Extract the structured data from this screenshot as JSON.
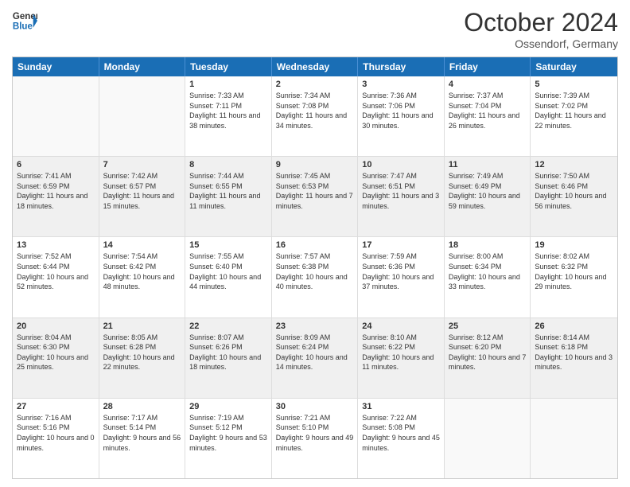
{
  "logo": {
    "line1": "General",
    "line2": "Blue"
  },
  "title": "October 2024",
  "subtitle": "Ossendorf, Germany",
  "days": [
    "Sunday",
    "Monday",
    "Tuesday",
    "Wednesday",
    "Thursday",
    "Friday",
    "Saturday"
  ],
  "rows": [
    [
      {
        "day": "",
        "sunrise": "",
        "sunset": "",
        "daylight": "",
        "empty": true
      },
      {
        "day": "",
        "sunrise": "",
        "sunset": "",
        "daylight": "",
        "empty": true
      },
      {
        "day": "1",
        "sunrise": "Sunrise: 7:33 AM",
        "sunset": "Sunset: 7:11 PM",
        "daylight": "Daylight: 11 hours and 38 minutes."
      },
      {
        "day": "2",
        "sunrise": "Sunrise: 7:34 AM",
        "sunset": "Sunset: 7:08 PM",
        "daylight": "Daylight: 11 hours and 34 minutes."
      },
      {
        "day": "3",
        "sunrise": "Sunrise: 7:36 AM",
        "sunset": "Sunset: 7:06 PM",
        "daylight": "Daylight: 11 hours and 30 minutes."
      },
      {
        "day": "4",
        "sunrise": "Sunrise: 7:37 AM",
        "sunset": "Sunset: 7:04 PM",
        "daylight": "Daylight: 11 hours and 26 minutes."
      },
      {
        "day": "5",
        "sunrise": "Sunrise: 7:39 AM",
        "sunset": "Sunset: 7:02 PM",
        "daylight": "Daylight: 11 hours and 22 minutes."
      }
    ],
    [
      {
        "day": "6",
        "sunrise": "Sunrise: 7:41 AM",
        "sunset": "Sunset: 6:59 PM",
        "daylight": "Daylight: 11 hours and 18 minutes."
      },
      {
        "day": "7",
        "sunrise": "Sunrise: 7:42 AM",
        "sunset": "Sunset: 6:57 PM",
        "daylight": "Daylight: 11 hours and 15 minutes."
      },
      {
        "day": "8",
        "sunrise": "Sunrise: 7:44 AM",
        "sunset": "Sunset: 6:55 PM",
        "daylight": "Daylight: 11 hours and 11 minutes."
      },
      {
        "day": "9",
        "sunrise": "Sunrise: 7:45 AM",
        "sunset": "Sunset: 6:53 PM",
        "daylight": "Daylight: 11 hours and 7 minutes."
      },
      {
        "day": "10",
        "sunrise": "Sunrise: 7:47 AM",
        "sunset": "Sunset: 6:51 PM",
        "daylight": "Daylight: 11 hours and 3 minutes."
      },
      {
        "day": "11",
        "sunrise": "Sunrise: 7:49 AM",
        "sunset": "Sunset: 6:49 PM",
        "daylight": "Daylight: 10 hours and 59 minutes."
      },
      {
        "day": "12",
        "sunrise": "Sunrise: 7:50 AM",
        "sunset": "Sunset: 6:46 PM",
        "daylight": "Daylight: 10 hours and 56 minutes."
      }
    ],
    [
      {
        "day": "13",
        "sunrise": "Sunrise: 7:52 AM",
        "sunset": "Sunset: 6:44 PM",
        "daylight": "Daylight: 10 hours and 52 minutes."
      },
      {
        "day": "14",
        "sunrise": "Sunrise: 7:54 AM",
        "sunset": "Sunset: 6:42 PM",
        "daylight": "Daylight: 10 hours and 48 minutes."
      },
      {
        "day": "15",
        "sunrise": "Sunrise: 7:55 AM",
        "sunset": "Sunset: 6:40 PM",
        "daylight": "Daylight: 10 hours and 44 minutes."
      },
      {
        "day": "16",
        "sunrise": "Sunrise: 7:57 AM",
        "sunset": "Sunset: 6:38 PM",
        "daylight": "Daylight: 10 hours and 40 minutes."
      },
      {
        "day": "17",
        "sunrise": "Sunrise: 7:59 AM",
        "sunset": "Sunset: 6:36 PM",
        "daylight": "Daylight: 10 hours and 37 minutes."
      },
      {
        "day": "18",
        "sunrise": "Sunrise: 8:00 AM",
        "sunset": "Sunset: 6:34 PM",
        "daylight": "Daylight: 10 hours and 33 minutes."
      },
      {
        "day": "19",
        "sunrise": "Sunrise: 8:02 AM",
        "sunset": "Sunset: 6:32 PM",
        "daylight": "Daylight: 10 hours and 29 minutes."
      }
    ],
    [
      {
        "day": "20",
        "sunrise": "Sunrise: 8:04 AM",
        "sunset": "Sunset: 6:30 PM",
        "daylight": "Daylight: 10 hours and 25 minutes."
      },
      {
        "day": "21",
        "sunrise": "Sunrise: 8:05 AM",
        "sunset": "Sunset: 6:28 PM",
        "daylight": "Daylight: 10 hours and 22 minutes."
      },
      {
        "day": "22",
        "sunrise": "Sunrise: 8:07 AM",
        "sunset": "Sunset: 6:26 PM",
        "daylight": "Daylight: 10 hours and 18 minutes."
      },
      {
        "day": "23",
        "sunrise": "Sunrise: 8:09 AM",
        "sunset": "Sunset: 6:24 PM",
        "daylight": "Daylight: 10 hours and 14 minutes."
      },
      {
        "day": "24",
        "sunrise": "Sunrise: 8:10 AM",
        "sunset": "Sunset: 6:22 PM",
        "daylight": "Daylight: 10 hours and 11 minutes."
      },
      {
        "day": "25",
        "sunrise": "Sunrise: 8:12 AM",
        "sunset": "Sunset: 6:20 PM",
        "daylight": "Daylight: 10 hours and 7 minutes."
      },
      {
        "day": "26",
        "sunrise": "Sunrise: 8:14 AM",
        "sunset": "Sunset: 6:18 PM",
        "daylight": "Daylight: 10 hours and 3 minutes."
      }
    ],
    [
      {
        "day": "27",
        "sunrise": "Sunrise: 7:16 AM",
        "sunset": "Sunset: 5:16 PM",
        "daylight": "Daylight: 10 hours and 0 minutes."
      },
      {
        "day": "28",
        "sunrise": "Sunrise: 7:17 AM",
        "sunset": "Sunset: 5:14 PM",
        "daylight": "Daylight: 9 hours and 56 minutes."
      },
      {
        "day": "29",
        "sunrise": "Sunrise: 7:19 AM",
        "sunset": "Sunset: 5:12 PM",
        "daylight": "Daylight: 9 hours and 53 minutes."
      },
      {
        "day": "30",
        "sunrise": "Sunrise: 7:21 AM",
        "sunset": "Sunset: 5:10 PM",
        "daylight": "Daylight: 9 hours and 49 minutes."
      },
      {
        "day": "31",
        "sunrise": "Sunrise: 7:22 AM",
        "sunset": "Sunset: 5:08 PM",
        "daylight": "Daylight: 9 hours and 45 minutes."
      },
      {
        "day": "",
        "sunrise": "",
        "sunset": "",
        "daylight": "",
        "empty": true
      },
      {
        "day": "",
        "sunrise": "",
        "sunset": "",
        "daylight": "",
        "empty": true
      }
    ]
  ]
}
